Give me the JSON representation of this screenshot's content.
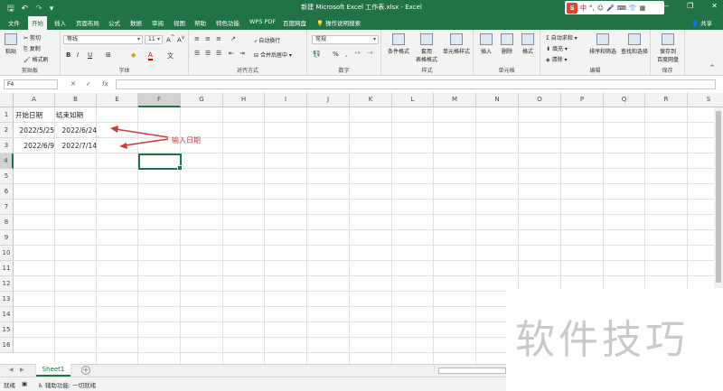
{
  "window": {
    "title": "新建 Microsoft Excel 工作表.xlsx  -  Excel",
    "share_label": "共享"
  },
  "ime": {
    "logo": "S",
    "mode": "中"
  },
  "tabs": [
    "文件",
    "开始",
    "插入",
    "页面布局",
    "公式",
    "数据",
    "审阅",
    "视图",
    "帮助",
    "特色功能",
    "WPS PDF",
    "百度网盘"
  ],
  "active_tab": "开始",
  "tell_me": "操作说明搜索",
  "ribbon": {
    "clipboard": {
      "paste": "粘贴",
      "cut": "剪切",
      "copy": "复制",
      "format_painter": "格式刷",
      "label": "剪贴板"
    },
    "font": {
      "name": "等线",
      "size": "11",
      "label": "字体"
    },
    "alignment": {
      "wrap": "自动换行",
      "merge": "合并后居中",
      "label": "对齐方式"
    },
    "number": {
      "format": "常规",
      "label": "数字"
    },
    "styles": {
      "conditional": "条件格式",
      "table": "套用\n表格格式",
      "cell": "单元格样式",
      "label": "样式"
    },
    "cells": {
      "insert": "插入",
      "delete": "删除",
      "format": "格式",
      "label": "单元格"
    },
    "editing": {
      "autosum": "自动求和",
      "fill": "填充",
      "clear": "清除",
      "sort": "排序和筛选",
      "find": "查找和选择",
      "label": "编辑"
    },
    "save": {
      "line1": "保存到",
      "line2": "百度网盘",
      "label": "保存"
    }
  },
  "formula_bar": {
    "name_box": "F4",
    "formula": ""
  },
  "grid": {
    "columns": [
      "A",
      "B",
      "E",
      "F",
      "G",
      "H",
      "I",
      "J",
      "K",
      "L",
      "M",
      "N",
      "O",
      "P",
      "Q",
      "R",
      "S"
    ],
    "selected_column": "F",
    "rows": [
      "1",
      "2",
      "3",
      "4",
      "5",
      "6",
      "7",
      "8",
      "9",
      "10",
      "11",
      "12",
      "13",
      "14",
      "15",
      "16"
    ],
    "selected_row": "4",
    "cells": {
      "A1": "开始日期",
      "B1": "结束如期",
      "A2": "2022/5/25",
      "B2": "2022/6/24",
      "A3": "2022/6/9",
      "B3": "2022/7/14"
    },
    "annotation": "输入日期",
    "annotation_color": "#d23a3a"
  },
  "sheets": [
    "Sheet1"
  ],
  "status": {
    "ready": "就绪",
    "accessibility": "辅助功能: 一切就绪"
  },
  "watermark": "软件技巧",
  "colors": {
    "excel_green": "#217346"
  }
}
